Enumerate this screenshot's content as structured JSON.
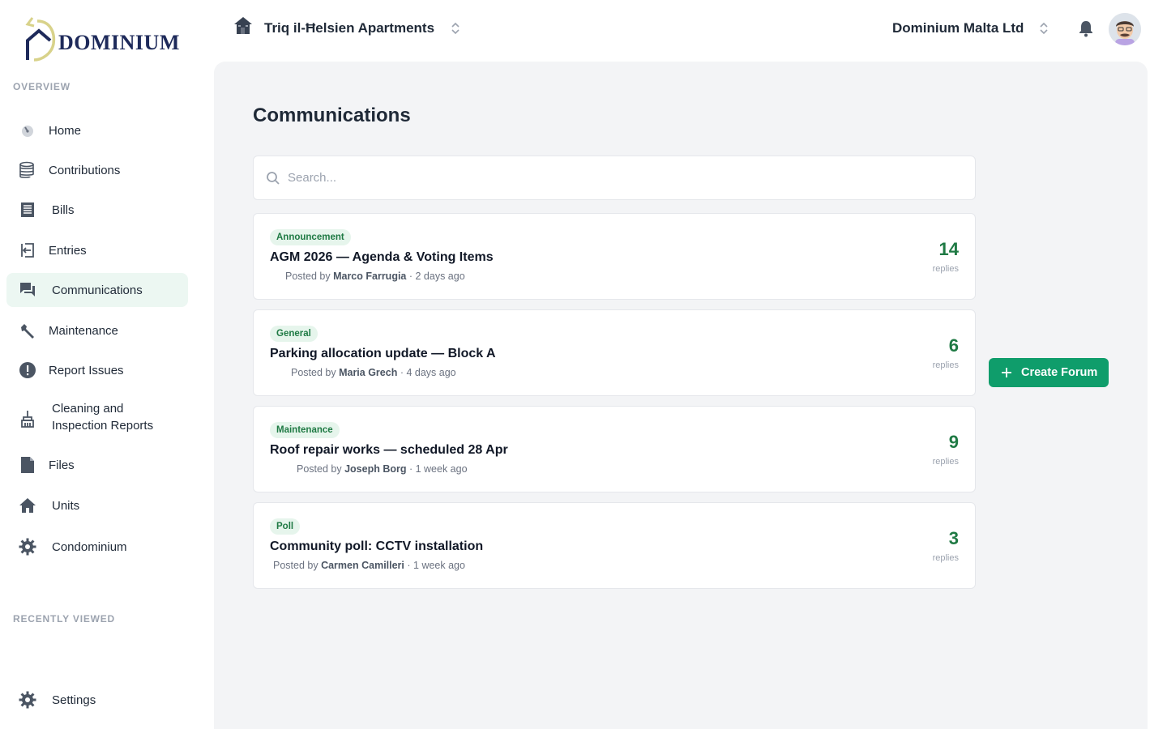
{
  "brand": {
    "name": "Dominium"
  },
  "header": {
    "property": "Triq il-Ħelsien Apartments",
    "organization": "Dominium Malta Ltd"
  },
  "sidebar": {
    "overview_label": "OVERVIEW",
    "recent_label": "RECENTLY VIEWED",
    "items": [
      {
        "label": "Home",
        "icon": "dashboard-icon"
      },
      {
        "label": "Contributions",
        "icon": "coins-icon"
      },
      {
        "label": "Bills",
        "icon": "receipt-icon"
      },
      {
        "label": "Entries",
        "icon": "entry-icon"
      },
      {
        "label": "Communications",
        "icon": "chat-icon",
        "active": true
      },
      {
        "label": "Maintenance",
        "icon": "wrench-icon"
      },
      {
        "label": "Report Issues",
        "icon": "alert-icon"
      },
      {
        "label": "Cleaning and Inspection Reports",
        "icon": "broom-icon"
      },
      {
        "label": "Files",
        "icon": "file-icon"
      },
      {
        "label": "Units",
        "icon": "home-icon"
      },
      {
        "label": "Condominium",
        "icon": "gear-icon"
      }
    ],
    "settings": {
      "label": "Settings",
      "icon": "gear-icon"
    }
  },
  "main": {
    "title": "Communications",
    "search_placeholder": "Search...",
    "create_label": "Create Forum",
    "replies_label": "replies",
    "posts": [
      {
        "tag": "Announcement",
        "title": "AGM 2026 — Agenda & Voting Items",
        "posted_by": "Posted by",
        "author": "Marco Farrugia",
        "time": "· 2 days ago",
        "replies": "14"
      },
      {
        "tag": "General",
        "title": "Parking allocation update — Block A",
        "posted_by": "Posted by",
        "author": "Maria Grech",
        "time": "· 4 days ago",
        "replies": "6"
      },
      {
        "tag": "Maintenance",
        "title": "Roof repair works — scheduled 28 Apr",
        "posted_by": "Posted by",
        "author": "Joseph Borg",
        "time": "· 1 week ago",
        "replies": "9"
      },
      {
        "tag": "Poll",
        "title": "Community poll: CCTV installation",
        "posted_by": "Posted by",
        "author": "Carmen Camilleri",
        "time": "· 1 week ago",
        "replies": "3"
      }
    ]
  },
  "colors": {
    "accent": "#0f9d6b",
    "active_bg": "#ecf7f2",
    "tag_bg": "#e6f5ec",
    "tag_text": "#1f7a44"
  }
}
